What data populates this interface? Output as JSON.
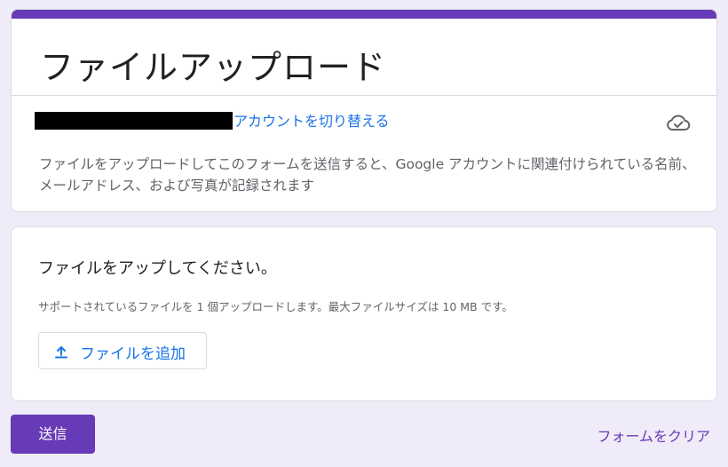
{
  "form": {
    "title": "ファイルアップロード",
    "account": {
      "email_redacted": "",
      "switch_account_label": "アカウントを切り替える"
    },
    "notice": "ファイルをアップロードしてこのフォームを送信すると、Google アカウントに関連付けられている名前、メールアドレス、および写真が記録されます",
    "icons": {
      "saved": "cloud-done-icon",
      "upload": "upload-icon"
    },
    "colors": {
      "accent": "#673ab7",
      "link": "#1a73e8",
      "background": "#f0ebf8"
    }
  },
  "question": {
    "title": "ファイルをアップしてください。",
    "help": "サポートされているファイルを 1 個アップロードします。最大ファイルサイズは 10 MB です。",
    "add_file_label": "ファイルを追加"
  },
  "actions": {
    "submit_label": "送信",
    "clear_label": "フォームをクリア"
  }
}
